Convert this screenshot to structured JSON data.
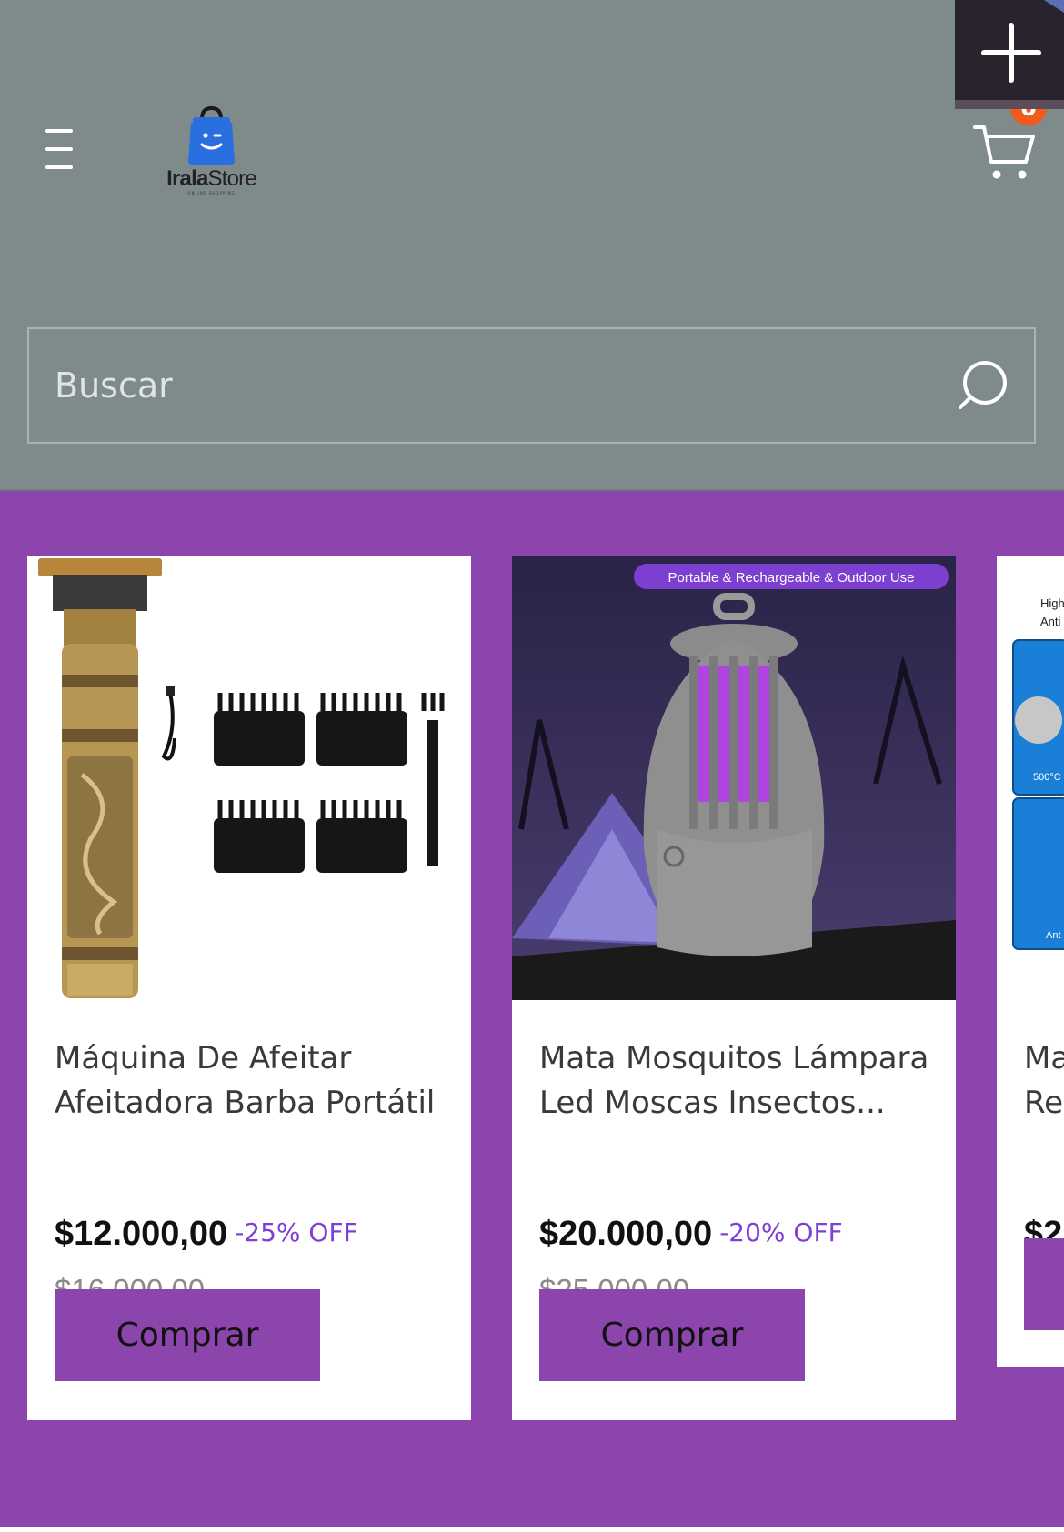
{
  "header": {
    "logo_text_bold": "Irala",
    "logo_text": "Store",
    "logo_tagline": "ONLINE SHOPPING",
    "cart_count": "0"
  },
  "search": {
    "placeholder": "Buscar"
  },
  "products": [
    {
      "title": "Máquina De Afeitar Afeitadora Barba Portátil",
      "price": "$12.000,00",
      "discount": "-25% OFF",
      "old_price": "$16.000,00",
      "button": "Comprar"
    },
    {
      "title": "Mata Mosquitos Lámpara Led Moscas Insectos...",
      "price": "$20.000,00",
      "discount": "-20% OFF",
      "old_price": "$25.000,00",
      "button": "Comprar",
      "image_banner": "Portable & Rechargeable & Outdoor Use"
    },
    {
      "title": "Ma Re",
      "price": "$2",
      "image_labels": [
        "High",
        "Anti",
        "500°C",
        "Ant"
      ]
    }
  ],
  "colors": {
    "header_bg": "#7f8b8b",
    "products_bg": "#8c45ad",
    "discount": "#7e3fd6",
    "badge": "#f05a1a"
  }
}
